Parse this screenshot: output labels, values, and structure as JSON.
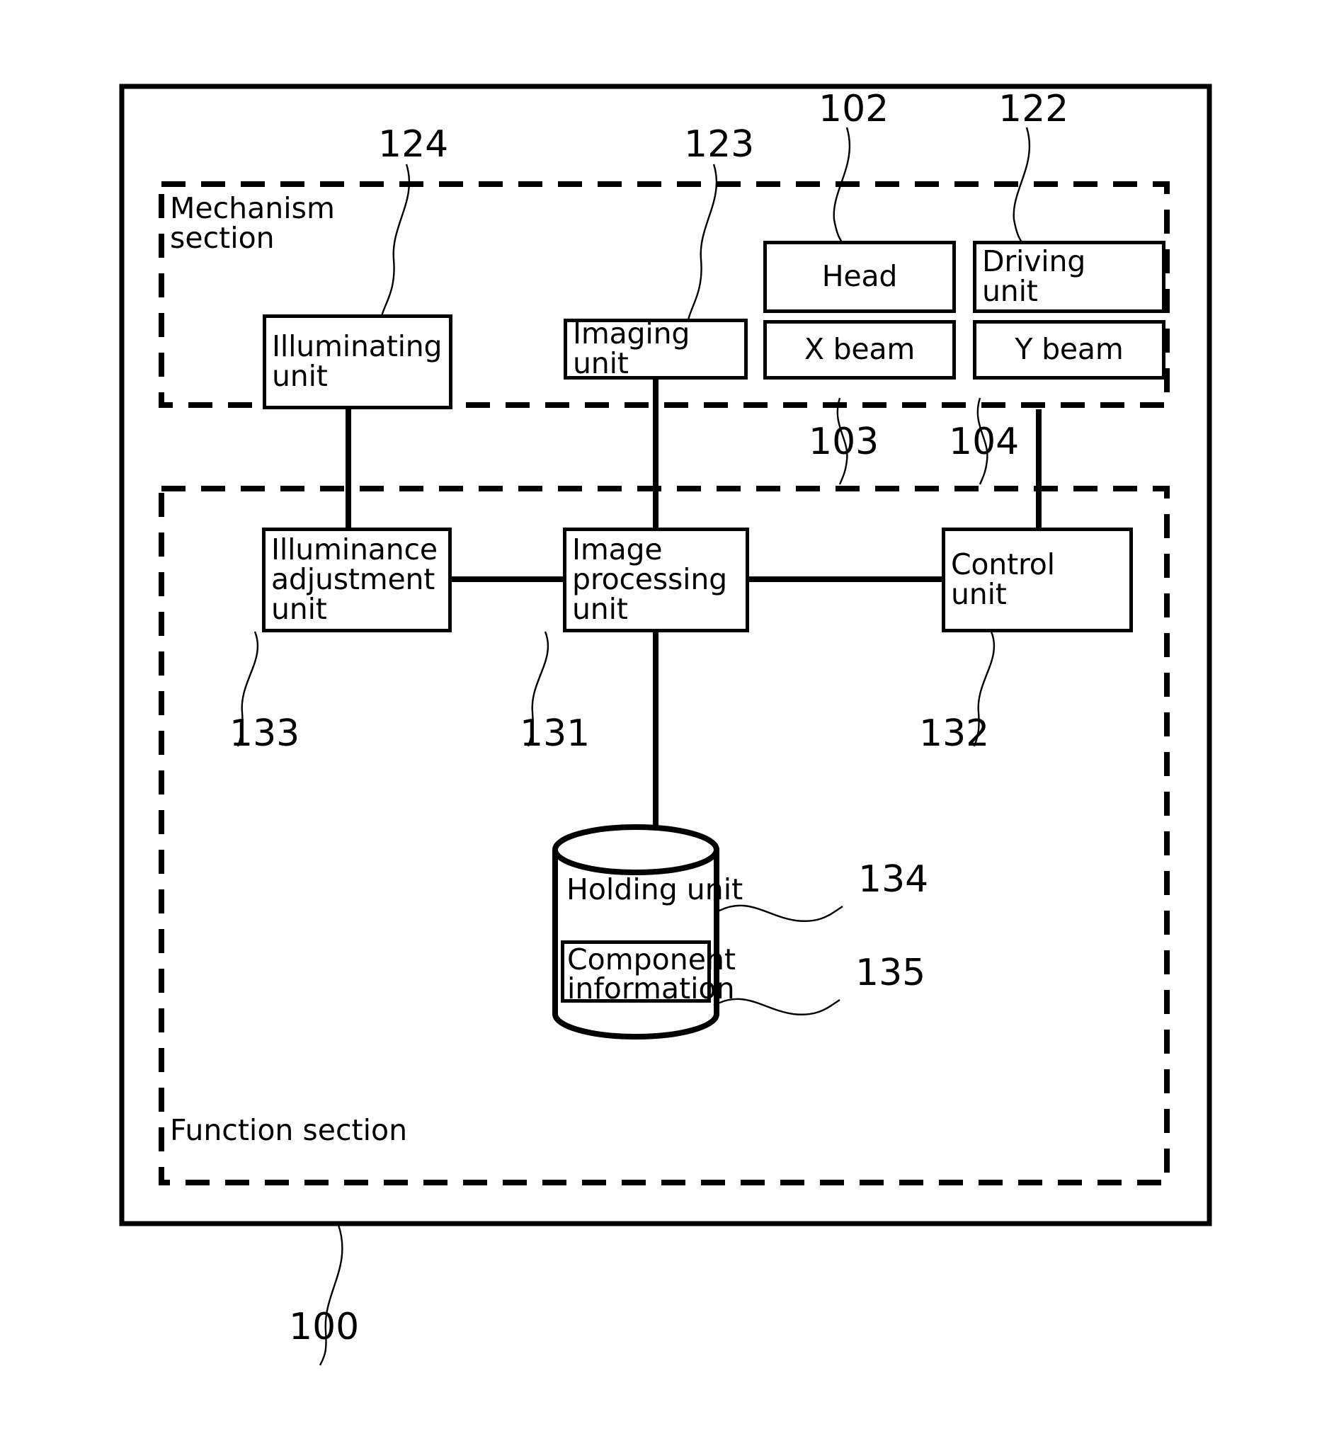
{
  "figure": {
    "outer_frame_ref": "100",
    "sections": [
      {
        "id": "mechanism",
        "label": "Mechanism\nsection"
      },
      {
        "id": "function",
        "label": "Function section"
      }
    ],
    "mechanism_boxes": [
      {
        "id": "illuminating-unit",
        "label": "Illuminating\nunit",
        "ref": "124"
      },
      {
        "id": "imaging-unit",
        "label": "Imaging\nunit",
        "ref": "123"
      },
      {
        "id": "head",
        "label": "Head",
        "ref": "102"
      },
      {
        "id": "driving-unit",
        "label": "Driving\nunit",
        "ref": "122"
      },
      {
        "id": "x-beam",
        "label": "X beam",
        "ref": "103"
      },
      {
        "id": "y-beam",
        "label": "Y beam",
        "ref": "104"
      }
    ],
    "function_boxes": [
      {
        "id": "illuminance-adjustment-unit",
        "label": "Illuminance\nadjustment\nunit",
        "ref": "133"
      },
      {
        "id": "image-processing-unit",
        "label": "Image\nprocessing\nunit",
        "ref": "131"
      },
      {
        "id": "control-unit",
        "label": "Control\nunit",
        "ref": "132"
      }
    ],
    "database": {
      "id": "holding-unit",
      "label": "Holding unit",
      "ref": "134",
      "inner": {
        "id": "component-information",
        "label": "Component\ninformation",
        "ref": "135"
      }
    },
    "ref_numbers": {
      "outer": "100",
      "illuminating": "124",
      "imaging": "123",
      "head": "102",
      "driving": "122",
      "xbeam": "103",
      "ybeam": "104",
      "illuminance_adj": "133",
      "image_proc": "131",
      "control": "132",
      "holding": "134",
      "component_info": "135"
    },
    "colors": {
      "stroke": "#000000",
      "background": "#ffffff"
    }
  }
}
